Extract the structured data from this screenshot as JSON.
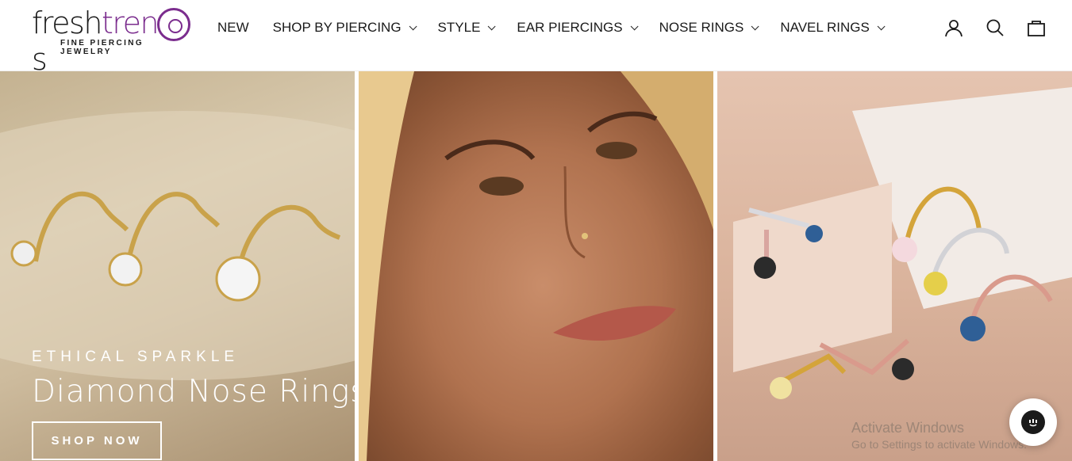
{
  "logo": {
    "word_dark": "fresh",
    "word_accent": "tren",
    "word_end": "s",
    "tagline": "FINE PIERCING JEWELRY",
    "accent_color": "#7b2d8e"
  },
  "nav": {
    "items": [
      {
        "label": "NEW",
        "has_dropdown": false
      },
      {
        "label": "SHOP BY PIERCING",
        "has_dropdown": true
      },
      {
        "label": "STYLE",
        "has_dropdown": true
      },
      {
        "label": "EAR PIERCINGS",
        "has_dropdown": true
      },
      {
        "label": "NOSE RINGS",
        "has_dropdown": true
      },
      {
        "label": "NAVEL RINGS",
        "has_dropdown": true
      }
    ]
  },
  "header_icons": [
    "account-icon",
    "search-icon",
    "cart-icon"
  ],
  "hero": {
    "eyebrow": "ETHICAL SPARKLE",
    "headline": "Diamond Nose Rings",
    "cta_label": "SHOP NOW"
  },
  "watermark": {
    "title": "Activate Windows",
    "subtitle": "Go to Settings to activate Windows."
  }
}
